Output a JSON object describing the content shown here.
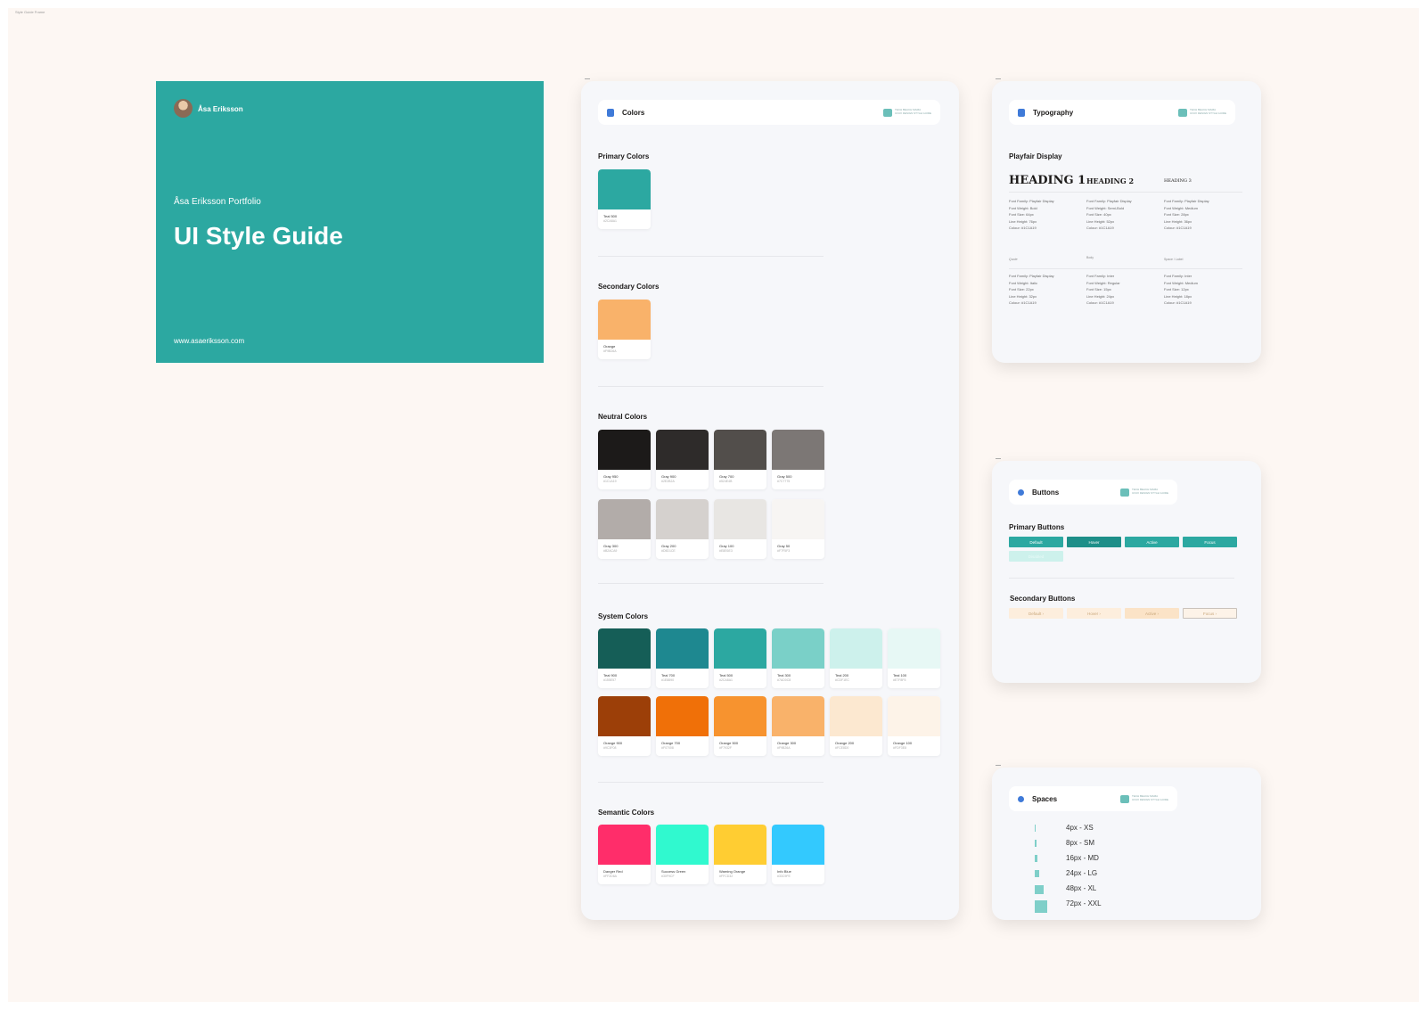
{
  "canvas": {
    "label": "Style Guide Frame"
  },
  "cover": {
    "author": "Åsa Eriksson",
    "kicker": "Åsa Eriksson Portfolio",
    "title": "UI Style Guide",
    "url": "www.asaeriksson.com",
    "bg": "#2ca8a1"
  },
  "logo": {
    "line1": "TECH BEACH MAMA",
    "line2": "UI/UX DESIGN STYLE GUIDE"
  },
  "colors": {
    "header": "Colors",
    "primary": {
      "title": "Primary Colors",
      "items": [
        {
          "name": "Teal 500",
          "hex": "#2CA8A1",
          "color": "#2ca8a1"
        }
      ]
    },
    "secondary": {
      "title": "Secondary Colors",
      "items": [
        {
          "name": "Orange",
          "hex": "#F9B26A",
          "color": "#f9b26a"
        }
      ]
    },
    "neutral": {
      "title": "Neutral Colors",
      "items": [
        {
          "name": "Gray 950",
          "hex": "#1C1A19",
          "color": "#1c1a19"
        },
        {
          "name": "Gray 900",
          "hex": "#2E2B2A",
          "color": "#2e2b2a"
        },
        {
          "name": "Gray 700",
          "hex": "#524E4B",
          "color": "#524e4b"
        },
        {
          "name": "Gray 500",
          "hex": "#7C7775",
          "color": "#7c7775"
        },
        {
          "name": "Gray 300",
          "hex": "#B2ACA9",
          "color": "#b2aca9"
        },
        {
          "name": "Gray 200",
          "hex": "#D5D1CE",
          "color": "#d5d1ce"
        },
        {
          "name": "Gray 100",
          "hex": "#E8E6E3",
          "color": "#e8e6e3"
        },
        {
          "name": "Gray 50",
          "hex": "#F7F5F3",
          "color": "#f7f5f3"
        }
      ]
    },
    "system": {
      "title": "System Colors",
      "items": [
        {
          "name": "Teal 900",
          "hex": "#155E57",
          "color": "#155e57"
        },
        {
          "name": "Teal 700",
          "hex": "#1E8890",
          "color": "#1e8890"
        },
        {
          "name": "Teal 500",
          "hex": "#2CA8A1",
          "color": "#2ca8a1"
        },
        {
          "name": "Teal 300",
          "hex": "#7AD0C8",
          "color": "#7ad0c8"
        },
        {
          "name": "Teal 200",
          "hex": "#CDF1EC",
          "color": "#cdf1ec"
        },
        {
          "name": "Teal 100",
          "hex": "#E7F8F5",
          "color": "#e7f8f5"
        },
        {
          "name": "Orange 900",
          "hex": "#9C3F08",
          "color": "#9c3f08"
        },
        {
          "name": "Orange 700",
          "hex": "#F07008",
          "color": "#f07008"
        },
        {
          "name": "Orange 500",
          "hex": "#F7932F",
          "color": "#f7932f"
        },
        {
          "name": "Orange 300",
          "hex": "#F9B26A",
          "color": "#f9b26a"
        },
        {
          "name": "Orange 200",
          "hex": "#FCE8D0",
          "color": "#fce8d0"
        },
        {
          "name": "Orange 100",
          "hex": "#FDF3E8",
          "color": "#fdf3e8"
        }
      ]
    },
    "semantic": {
      "title": "Semantic Colors",
      "items": [
        {
          "name": "Danger Red",
          "hex": "#FF2D6A",
          "color": "#ff2d6a"
        },
        {
          "name": "Success Green",
          "hex": "#30F9CF",
          "color": "#30f9cf"
        },
        {
          "name": "Warning Orange",
          "hex": "#FFCD32",
          "color": "#ffcd32"
        },
        {
          "name": "Info Blue",
          "hex": "#33C9FE",
          "color": "#33c9fe"
        }
      ]
    }
  },
  "typography": {
    "header": "Typography",
    "family": "Playfair Display",
    "headings": [
      "HEADING 1",
      "HEADING 2",
      "HEADING 3"
    ],
    "specs_top": [
      [
        "Font Family: Playfair Display",
        "Font Weight: Bold",
        "Font Size: 64px",
        "Line Height: 76px",
        "Colour: #1C1A19"
      ],
      [
        "Font Family: Playfair Display",
        "Font Weight: Semi-Bold",
        "Font Size: 40px",
        "Line Height: 52px",
        "Colour: #1C1A19"
      ],
      [
        "Font Family: Playfair Display",
        "Font Weight: Medium",
        "Font Size: 28px",
        "Line Height: 36px",
        "Colour: #1C1A19"
      ]
    ],
    "samples": [
      "Quote",
      "Body",
      "Space / Label"
    ],
    "specs_bottom": [
      [
        "Font Family: Playfair Display",
        "Font Weight: Italic",
        "Font Size: 22px",
        "Line Height: 32px",
        "Colour: #1C1A19"
      ],
      [
        "Font Family: Inter",
        "Font Weight: Regular",
        "Font Size: 15px",
        "Line Height: 24px",
        "Colour: #1C1A19"
      ],
      [
        "Font Family: Inter",
        "Font Weight: Medium",
        "Font Size: 12px",
        "Line Height: 18px",
        "Colour: #1C1A19"
      ]
    ]
  },
  "buttons": {
    "header": "Buttons",
    "primary_title": "Primary Buttons",
    "primary": [
      "Default",
      "Hover",
      "Active",
      "Focus"
    ],
    "primary_disabled": "Disabled",
    "secondary_title": "Secondary Buttons",
    "secondary": [
      "Default ›",
      "Hover ›",
      "Active ›",
      "Focus ›"
    ]
  },
  "spaces": {
    "header": "Spaces",
    "items": [
      "4px - XS",
      "8px - SM",
      "16px - MD",
      "24px - LG",
      "48px - XL",
      "72px - XXL"
    ]
  }
}
